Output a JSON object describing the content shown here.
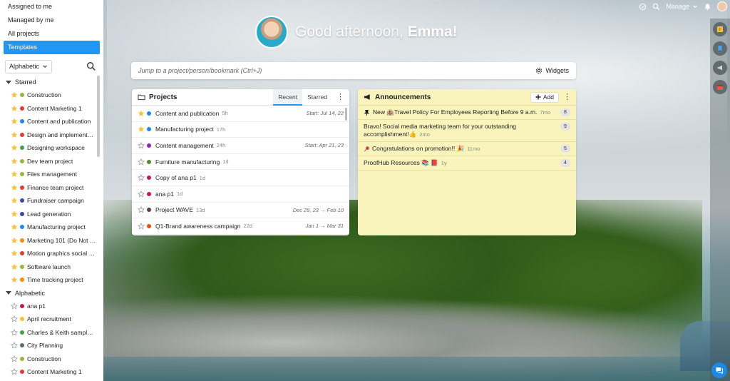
{
  "sidebar": {
    "nav": [
      {
        "label": "Assigned to me",
        "active": false
      },
      {
        "label": "Managed by me",
        "active": false
      },
      {
        "label": "All projects",
        "active": false
      },
      {
        "label": "Templates",
        "active": true
      }
    ],
    "sort_label": "Alphabetic",
    "starred_heading": "Starred",
    "alphabetic_heading": "Alphabetic",
    "starred": [
      {
        "name": "Construction",
        "color": "#9ab53b"
      },
      {
        "name": "Content Marketing 1",
        "color": "#e53935"
      },
      {
        "name": "Content and publication",
        "color": "#1e88e5"
      },
      {
        "name": "Design and implementati...",
        "color": "#e53935"
      },
      {
        "name": "Designing workspace",
        "color": "#43a047"
      },
      {
        "name": "Dev team project",
        "color": "#9ab53b"
      },
      {
        "name": "Files management",
        "color": "#9ab53b"
      },
      {
        "name": "Finance team project",
        "color": "#e53935"
      },
      {
        "name": "Fundraiser campaign",
        "color": "#3949ab"
      },
      {
        "name": "Lead generation",
        "color": "#3949ab"
      },
      {
        "name": "Manufacturing project",
        "color": "#1e88e5"
      },
      {
        "name": "Marketing 101 (Do Not D...",
        "color": "#fb8c00"
      },
      {
        "name": "Motion graphics social m...",
        "color": "#e53935"
      },
      {
        "name": "Software launch",
        "color": "#9ab53b"
      },
      {
        "name": "Time tracking project",
        "color": "#fb8c00"
      }
    ],
    "alphabetic": [
      {
        "name": "ana p1",
        "color": "#c2185b"
      },
      {
        "name": "April recruitment",
        "color": "#fbc02d"
      },
      {
        "name": "Charles & Keith sample p...",
        "color": "#43a047"
      },
      {
        "name": "City Planning",
        "color": "#546e7a"
      },
      {
        "name": "Construction",
        "color": "#9ab53b"
      },
      {
        "name": "Content Marketing 1",
        "color": "#e53935"
      }
    ]
  },
  "topbar": {
    "manage_label": "Manage"
  },
  "greeting": {
    "prefix": "Good afternoon, ",
    "name": "Emma!"
  },
  "jump": {
    "placeholder": "Jump to a project/person/bookmark (Ctrl+J)",
    "widgets_label": "Widgets"
  },
  "projects_card": {
    "title": "Projects",
    "tabs": [
      "Recent",
      "Starred"
    ],
    "rows": [
      {
        "name": "Content and publication",
        "time": "5h",
        "date": "Start: Jul 14, 22",
        "starred": true,
        "color": "#1e88e5"
      },
      {
        "name": "Manufacturing project",
        "time": "17h",
        "date": "",
        "starred": true,
        "color": "#1e88e5"
      },
      {
        "name": "Content management",
        "time": "24h",
        "date": "Start: Apr 21, 23",
        "starred": false,
        "color": "#8e24aa"
      },
      {
        "name": "Furniture manufacturing",
        "time": "1d",
        "date": "",
        "starred": false,
        "color": "#558b2f"
      },
      {
        "name": "Copy of ana p1",
        "time": "1d",
        "date": "",
        "starred": false,
        "color": "#c2185b"
      },
      {
        "name": "ana p1",
        "time": "1d",
        "date": "",
        "starred": false,
        "color": "#c2185b"
      },
      {
        "name": "Project WAVE",
        "time": "13d",
        "date": "Dec 29, 23 → Feb 10",
        "starred": false,
        "color": "#5d4037"
      },
      {
        "name": "Q1-Brand awareness campaign",
        "time": "22d",
        "date": "Jan 1 → Mar 31",
        "starred": false,
        "color": "#e65100"
      }
    ]
  },
  "announcements_card": {
    "title": "Announcements",
    "add_label": "Add",
    "rows": [
      {
        "icon": "pin",
        "text": "New 🏨Travel Policy For Employees Reporting Before 9 a.m.",
        "time": "7mo",
        "count": "8"
      },
      {
        "icon": "",
        "text": "Bravo! Social media marketing team for your outstanding accomplishment!👍",
        "time": "2mo",
        "count": "9"
      },
      {
        "icon": "pushpin-red",
        "text": "Congratulations on promotion!! 🎉",
        "time": "11mo",
        "count": "5"
      },
      {
        "icon": "",
        "text": "ProofHub Resources 📚 📕",
        "time": "1y",
        "count": "4"
      }
    ]
  },
  "colors": {
    "accent": "#2196f3",
    "announcement_bg": "#f9f3bc",
    "star": "#f9c33c"
  }
}
